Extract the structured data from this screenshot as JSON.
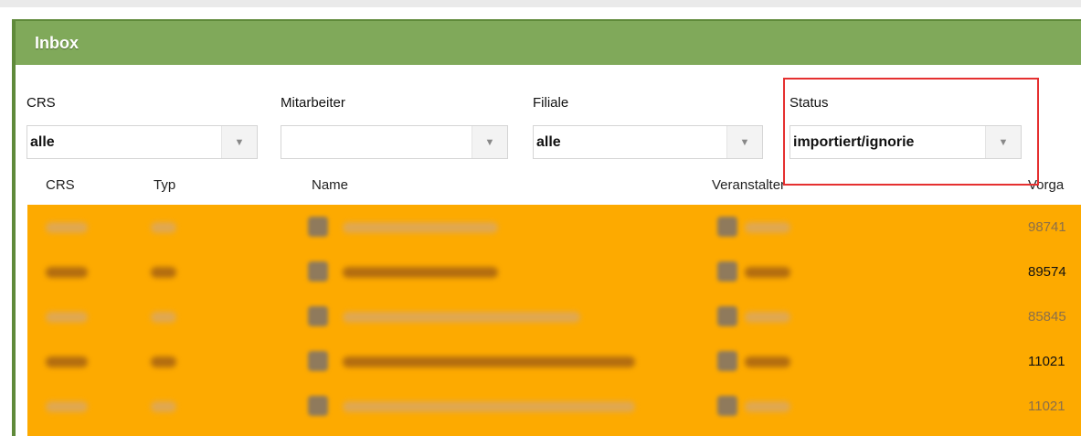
{
  "panel": {
    "title": "Inbox"
  },
  "filters": [
    {
      "label": "CRS",
      "value": "alle"
    },
    {
      "label": "Mitarbeiter",
      "value": ""
    },
    {
      "label": "Filiale",
      "value": "alle"
    },
    {
      "label": "Status",
      "value": "importiert/ignorie"
    }
  ],
  "columns": [
    "CRS",
    "Typ",
    "Name",
    "Veranstalter",
    "Vorga"
  ],
  "rows": [
    {
      "vorgang": "98741"
    },
    {
      "vorgang": "89574"
    },
    {
      "vorgang": "85845"
    },
    {
      "vorgang": "11021"
    },
    {
      "vorgang": "11021"
    }
  ],
  "colors": {
    "header": "#80a95a",
    "border": "#5f8a3a",
    "rows": "#fdaa00",
    "highlight": "#e53030"
  },
  "icons": {
    "dropdown": "chevron-down-icon"
  }
}
